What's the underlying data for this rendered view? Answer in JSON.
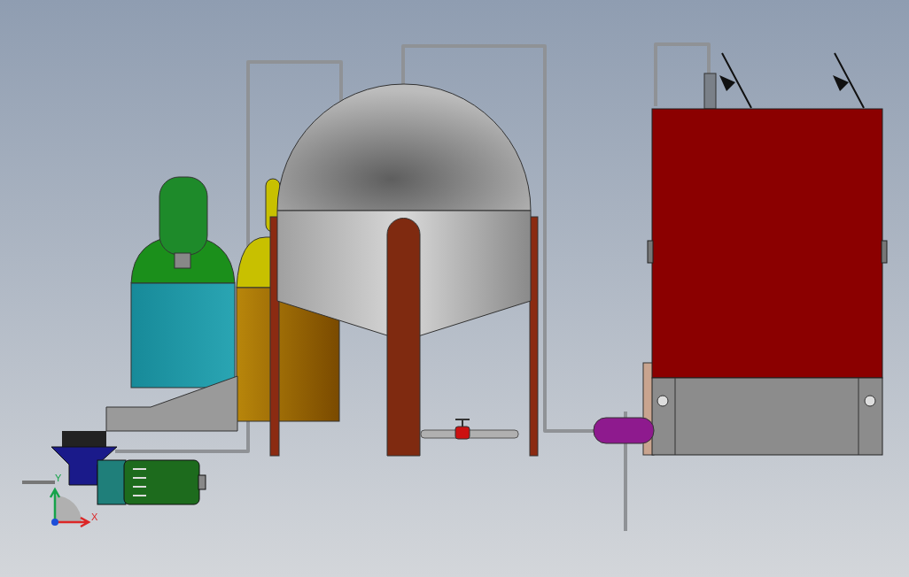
{
  "viewport": {
    "axis_labels": [
      "Y",
      "X"
    ]
  }
}
